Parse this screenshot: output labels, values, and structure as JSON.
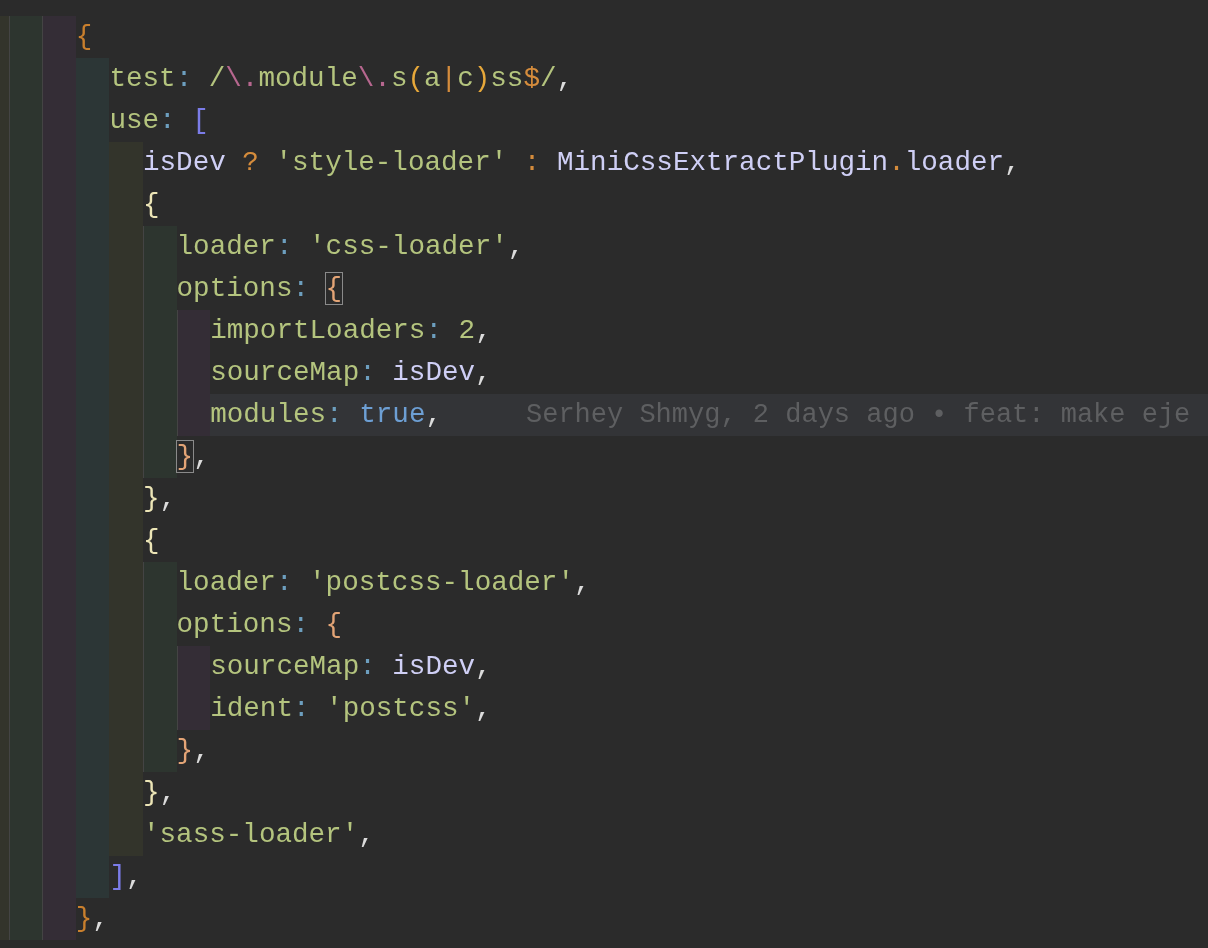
{
  "editor": {
    "lines": [
      {
        "current": false,
        "tokens": [
          {
            "text": "{",
            "kind": "brace-outer"
          }
        ],
        "children": [
          {
            "current": false,
            "tokens": [
              {
                "text": "test",
                "kind": "key"
              },
              {
                "text": ":",
                "kind": "colon"
              },
              {
                "text": " /",
                "kind": "regex"
              },
              {
                "text": "\\.",
                "kind": "escape"
              },
              {
                "text": "module",
                "kind": "regex"
              },
              {
                "text": "\\.",
                "kind": "escape"
              },
              {
                "text": "s",
                "kind": "regex"
              },
              {
                "text": "(",
                "kind": "group"
              },
              {
                "text": "a",
                "kind": "regex"
              },
              {
                "text": "|",
                "kind": "operator"
              },
              {
                "text": "c",
                "kind": "regex"
              },
              {
                "text": ")",
                "kind": "group"
              },
              {
                "text": "ss",
                "kind": "regex"
              },
              {
                "text": "$",
                "kind": "operator"
              },
              {
                "text": "/",
                "kind": "regex"
              },
              {
                "text": ",",
                "kind": "punct"
              }
            ]
          },
          {
            "current": false,
            "tokens": [
              {
                "text": "use",
                "kind": "key"
              },
              {
                "text": ":",
                "kind": "colon"
              },
              {
                "text": " [",
                "kind": "bracket"
              }
            ],
            "children": [
              {
                "current": false,
                "tokens": [
                  {
                    "text": "isDev",
                    "kind": "variable"
                  },
                  {
                    "text": " ?",
                    "kind": "operator"
                  },
                  {
                    "text": " 'style-loader'",
                    "kind": "string"
                  },
                  {
                    "text": " :",
                    "kind": "operator"
                  },
                  {
                    "text": " MiniCssExtractPlugin",
                    "kind": "variable"
                  },
                  {
                    "text": ".",
                    "kind": "operator"
                  },
                  {
                    "text": "loader",
                    "kind": "variable"
                  },
                  {
                    "text": ",",
                    "kind": "punct"
                  }
                ]
              },
              {
                "current": false,
                "tokens": [
                  {
                    "text": "{",
                    "kind": "brace-inner"
                  }
                ],
                "children": [
                  {
                    "current": false,
                    "tokens": [
                      {
                        "text": "loader",
                        "kind": "key"
                      },
                      {
                        "text": ":",
                        "kind": "colon"
                      },
                      {
                        "text": " 'css-loader'",
                        "kind": "string"
                      },
                      {
                        "text": ",",
                        "kind": "punct"
                      }
                    ]
                  },
                  {
                    "current": false,
                    "tokens": [
                      {
                        "text": "options",
                        "kind": "key"
                      },
                      {
                        "text": ": ",
                        "kind": "colon"
                      },
                      {
                        "text": "{",
                        "kind": "brace-deep",
                        "matched": true
                      }
                    ],
                    "children": [
                      {
                        "current": false,
                        "tokens": [
                          {
                            "text": "importLoaders",
                            "kind": "key"
                          },
                          {
                            "text": ":",
                            "kind": "colon"
                          },
                          {
                            "text": " 2",
                            "kind": "string"
                          },
                          {
                            "text": ",",
                            "kind": "punct"
                          }
                        ]
                      },
                      {
                        "current": false,
                        "tokens": [
                          {
                            "text": "sourceMap",
                            "kind": "key"
                          },
                          {
                            "text": ":",
                            "kind": "colon"
                          },
                          {
                            "text": " isDev",
                            "kind": "variable"
                          },
                          {
                            "text": ",",
                            "kind": "punct"
                          }
                        ]
                      },
                      {
                        "current": true,
                        "tokens": [
                          {
                            "text": "modules",
                            "kind": "key"
                          },
                          {
                            "text": ":",
                            "kind": "colon"
                          },
                          {
                            "text": " true",
                            "kind": "boolean"
                          },
                          {
                            "text": ",",
                            "kind": "punct"
                          }
                        ],
                        "blame": "Serhey Shmyg, 2 days ago • feat: make eje"
                      }
                    ]
                  },
                  {
                    "current": false,
                    "tokens": [
                      {
                        "text": "}",
                        "kind": "brace-deep",
                        "matched": true
                      },
                      {
                        "text": ",",
                        "kind": "punct"
                      }
                    ]
                  }
                ]
              },
              {
                "current": false,
                "tokens": [
                  {
                    "text": "}",
                    "kind": "brace-inner"
                  },
                  {
                    "text": ",",
                    "kind": "punct"
                  }
                ]
              },
              {
                "current": false,
                "tokens": [
                  {
                    "text": "{",
                    "kind": "brace-inner"
                  }
                ],
                "children": [
                  {
                    "current": false,
                    "tokens": [
                      {
                        "text": "loader",
                        "kind": "key"
                      },
                      {
                        "text": ":",
                        "kind": "colon"
                      },
                      {
                        "text": " 'postcss-loader'",
                        "kind": "string"
                      },
                      {
                        "text": ",",
                        "kind": "punct"
                      }
                    ]
                  },
                  {
                    "current": false,
                    "tokens": [
                      {
                        "text": "options",
                        "kind": "key"
                      },
                      {
                        "text": ":",
                        "kind": "colon"
                      },
                      {
                        "text": " {",
                        "kind": "brace-deep"
                      }
                    ],
                    "children": [
                      {
                        "current": false,
                        "tokens": [
                          {
                            "text": "sourceMap",
                            "kind": "key"
                          },
                          {
                            "text": ":",
                            "kind": "colon"
                          },
                          {
                            "text": " isDev",
                            "kind": "variable"
                          },
                          {
                            "text": ",",
                            "kind": "punct"
                          }
                        ]
                      },
                      {
                        "current": false,
                        "tokens": [
                          {
                            "text": "ident",
                            "kind": "key"
                          },
                          {
                            "text": ":",
                            "kind": "colon"
                          },
                          {
                            "text": " 'postcss'",
                            "kind": "string"
                          },
                          {
                            "text": ",",
                            "kind": "punct"
                          }
                        ]
                      }
                    ]
                  },
                  {
                    "current": false,
                    "tokens": [
                      {
                        "text": "}",
                        "kind": "brace-deep"
                      },
                      {
                        "text": ",",
                        "kind": "punct"
                      }
                    ]
                  }
                ]
              },
              {
                "current": false,
                "tokens": [
                  {
                    "text": "}",
                    "kind": "brace-inner"
                  },
                  {
                    "text": ",",
                    "kind": "punct"
                  }
                ]
              },
              {
                "current": false,
                "tokens": [
                  {
                    "text": "'sass-loader'",
                    "kind": "string"
                  },
                  {
                    "text": ",",
                    "kind": "punct"
                  }
                ]
              }
            ]
          },
          {
            "current": false,
            "tokens": [
              {
                "text": "]",
                "kind": "bracket"
              },
              {
                "text": ",",
                "kind": "punct"
              }
            ]
          }
        ]
      },
      {
        "current": false,
        "tokens": [
          {
            "text": "}",
            "kind": "brace-outer"
          },
          {
            "text": ",",
            "kind": "punct"
          }
        ]
      }
    ]
  }
}
